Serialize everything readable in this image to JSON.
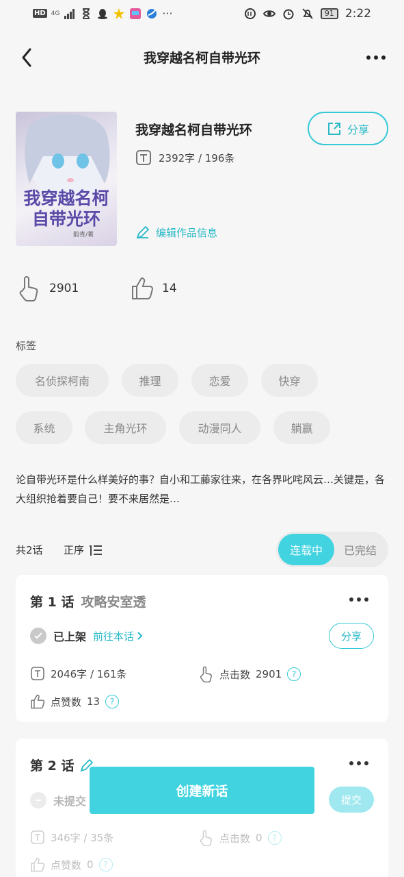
{
  "status_bar": {
    "network": "HD",
    "signal": "4G",
    "battery": "91",
    "time": "2:22"
  },
  "nav": {
    "title": "我穿越名柯自带光环"
  },
  "book": {
    "cover_text": "我穿越名柯自带光环",
    "cover_author": "韵青/著",
    "title": "我穿越名柯自带光环",
    "meta": "2392字 / 196条",
    "share_label": "分享",
    "edit_label": "编辑作品信息",
    "clicks": "2901",
    "likes": "14"
  },
  "tags": {
    "label": "标签",
    "items": [
      "名侦探柯南",
      "推理",
      "恋爱",
      "快穿",
      "系统",
      "主角光环",
      "动漫同人",
      "躺赢"
    ]
  },
  "description": "论自带光环是什么样美好的事？自小和工藤家往来，在各界叱咤风云…关键是，各大组织抢着要自己！要不来居然是…",
  "episodes_header": {
    "count": "共2话",
    "order": "正序",
    "segment": {
      "active": "连载中",
      "inactive": "已完结"
    }
  },
  "episodes": [
    {
      "number": "第 1 话",
      "subtitle": "攻略安室透",
      "status": "已上架",
      "goto": "前往本话",
      "action": "分享",
      "words": "2046字 / 161条",
      "clicks_label": "点击数",
      "clicks": "2901",
      "likes_label": "点赞数",
      "likes": "13"
    },
    {
      "number": "第 2 话",
      "status": "未提交",
      "action": "提交",
      "words": "346字 / 35条",
      "clicks_label": "点击数",
      "clicks": "0",
      "likes_label": "点赞数",
      "likes": "0"
    }
  ],
  "create_button": "创建新话",
  "colors": {
    "accent": "#41d3e0",
    "accent_text": "#27b9c7",
    "tag_bg": "#ececec"
  }
}
